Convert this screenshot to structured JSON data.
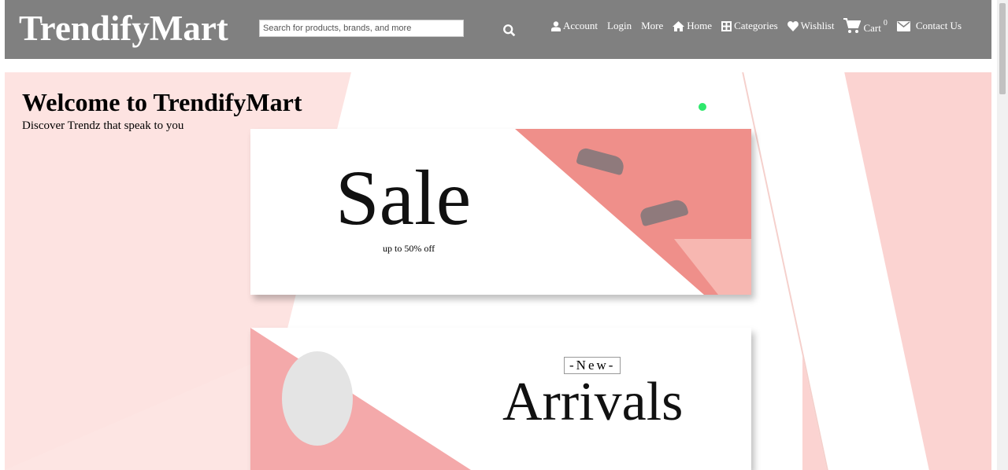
{
  "header": {
    "logo": "TrendifyMart",
    "search_placeholder": "Search for products, brands, and more",
    "nav": {
      "account": "Account",
      "login": "Login",
      "more": "More",
      "home": "Home",
      "categories": "Categories",
      "wishlist": "Wishlist",
      "cart": "Cart",
      "cart_count": "0",
      "contact": "Contact Us"
    }
  },
  "hero": {
    "title": "Welcome to TrendifyMart",
    "subtitle": "Discover Trendz that speak to you",
    "banner1": {
      "headline": "Sale",
      "caption": "up to 50% off"
    },
    "banner2": {
      "tag": "-New-",
      "headline": "Arrivals"
    }
  },
  "colors": {
    "header": "#808080",
    "pink": "#fbd3d1",
    "accent": "#ef8f8a"
  }
}
